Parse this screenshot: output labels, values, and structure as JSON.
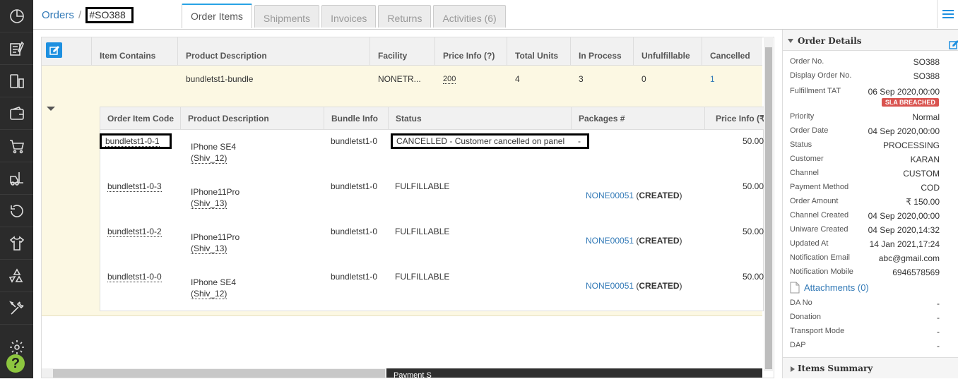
{
  "breadcrumb": {
    "root": "Orders",
    "separator": "/",
    "order_id": "#SO388"
  },
  "tabs": [
    {
      "label": "Order Items",
      "active": true
    },
    {
      "label": "Shipments",
      "active": false
    },
    {
      "label": "Invoices",
      "active": false
    },
    {
      "label": "Returns",
      "active": false
    },
    {
      "label": "Activities (6)",
      "active": false
    }
  ],
  "sidebar": {
    "icons": [
      "dashboard-icon",
      "orders-icon",
      "mobile-icon",
      "wallet-icon",
      "cart-icon",
      "forklift-icon",
      "returns-icon",
      "tshirt-icon",
      "recycle-icon",
      "tools-icon",
      "settings-icon",
      "help-icon"
    ],
    "help_label": "?"
  },
  "items_table": {
    "headers": [
      "Item Contains",
      "Product Description",
      "Facility",
      "Price Info (?)",
      "Total Units",
      "In Process",
      "Unfulfillable",
      "Cancelled"
    ],
    "row": {
      "product_description": "bundletst1-bundle",
      "facility": "NONETR...",
      "price": "200",
      "total_units": "4",
      "in_process": "3",
      "unfulfillable": "0",
      "cancelled": "1"
    }
  },
  "sub_table": {
    "headers": [
      "Order Item Code",
      "Product Description",
      "Bundle Info",
      "Status",
      "Packages #",
      "Price Info (₹)"
    ],
    "rows": [
      {
        "code": "bundletst1-0-1",
        "product": "IPhone SE4",
        "sku": "(Shiv_12)",
        "bundle": "bundletst1-0",
        "status": "CANCELLED - Customer cancelled on panel",
        "packages_dash": "-",
        "package": "",
        "package_status": "",
        "price": "50.00"
      },
      {
        "code": "bundletst1-0-3",
        "product": "IPhone11Pro",
        "sku": "(Shiv_13)",
        "bundle": "bundletst1-0",
        "status": "FULFILLABLE",
        "packages_dash": "",
        "package": "NONE00051",
        "package_status": "CREATED",
        "price": "50.00"
      },
      {
        "code": "bundletst1-0-2",
        "product": "IPhone11Pro",
        "sku": "(Shiv_13)",
        "bundle": "bundletst1-0",
        "status": "FULFILLABLE",
        "packages_dash": "",
        "package": "NONE00051",
        "package_status": "CREATED",
        "price": "50.00"
      },
      {
        "code": "bundletst1-0-0",
        "product": "IPhone SE4",
        "sku": "(Shiv_12)",
        "bundle": "bundletst1-0",
        "status": "FULFILLABLE",
        "packages_dash": "",
        "package": "NONE00051",
        "package_status": "CREATED",
        "price": "50.00"
      }
    ]
  },
  "bottom_bar_text": "Payment S",
  "order_details": {
    "title": "Order Details",
    "fields": [
      {
        "label": "Order No.",
        "value": "SO388"
      },
      {
        "label": "Display Order No.",
        "value": "SO388"
      },
      {
        "label": "Fulfillment TAT",
        "value": "06 Sep 2020,00:00"
      },
      {
        "label": "Priority",
        "value": "Normal"
      },
      {
        "label": "Order Date",
        "value": "04 Sep 2020,00:00"
      },
      {
        "label": "Status",
        "value": "PROCESSING"
      },
      {
        "label": "Customer",
        "value": "KARAN"
      },
      {
        "label": "Channel",
        "value": "CUSTOM"
      },
      {
        "label": "Payment Method",
        "value": "COD"
      },
      {
        "label": "Order Amount",
        "value": "₹ 150.00"
      },
      {
        "label": "Channel Created",
        "value": "04 Sep 2020,00:00"
      },
      {
        "label": "Uniware Created",
        "value": "04 Sep 2020,14:32"
      },
      {
        "label": "Updated At",
        "value": "14 Jan 2021,17:24"
      },
      {
        "label": "Notification Email",
        "value": "abc@gmail.com"
      },
      {
        "label": "Notification Mobile",
        "value": "6946578569"
      }
    ],
    "sla_badge": "SLA BREACHED",
    "attachments": "Attachments (0)",
    "extra_fields": [
      {
        "label": "DA No",
        "value": "-"
      },
      {
        "label": "Donation",
        "value": "-"
      },
      {
        "label": "Transport Mode",
        "value": "-"
      },
      {
        "label": "DAP",
        "value": "-"
      }
    ]
  },
  "items_summary": {
    "title": "Items Summary"
  },
  "colors": {
    "accent": "#29a3e5",
    "link": "#337ab7",
    "sidebar": "#2b2b2b",
    "row_highlight": "#fcf8e3",
    "sla": "#d9534f"
  }
}
